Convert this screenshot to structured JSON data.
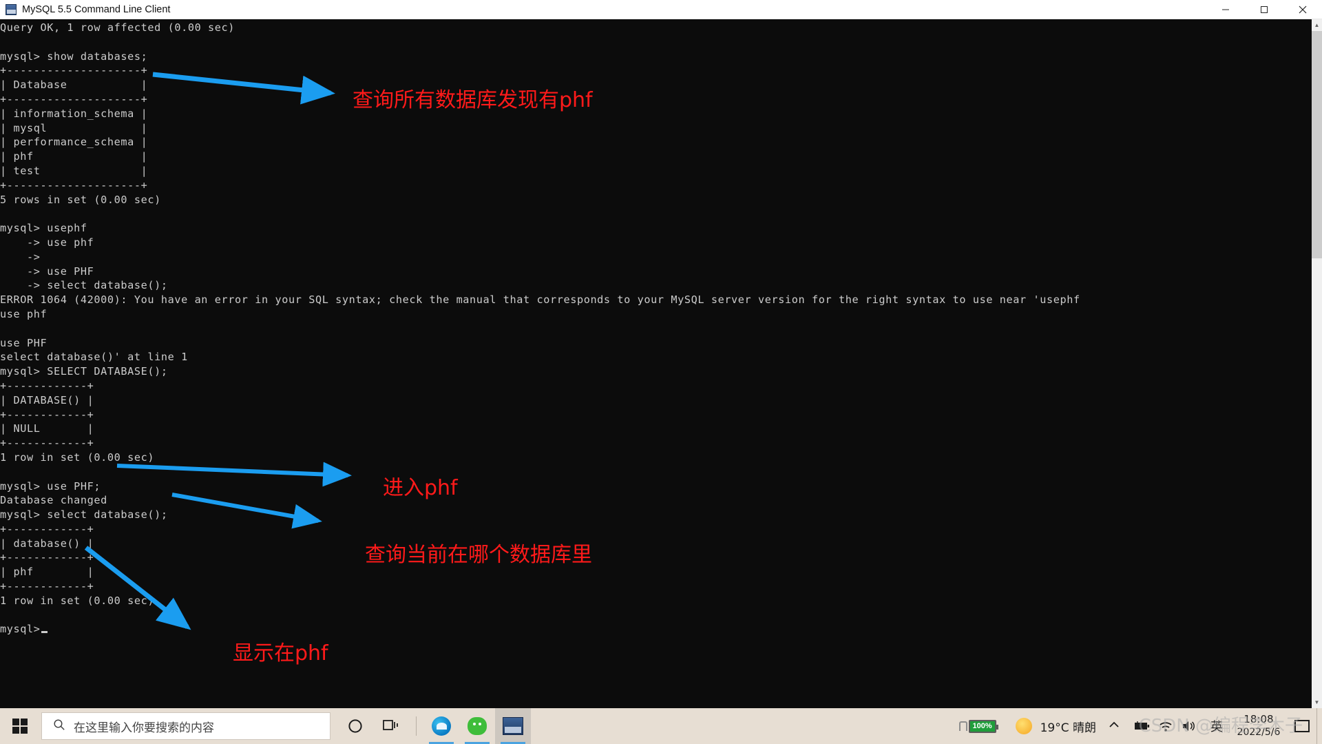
{
  "window": {
    "title": "MySQL 5.5 Command Line Client",
    "app_icon": "mysql-icon",
    "controls": {
      "minimize": "minimize-button",
      "maximize": "maximize-button",
      "close": "close-button"
    }
  },
  "console": {
    "lines": [
      "Query OK, 1 row affected (0.00 sec)",
      "",
      "mysql> show databases;",
      "+--------------------+",
      "| Database           |",
      "+--------------------+",
      "| information_schema |",
      "| mysql              |",
      "| performance_schema |",
      "| phf                |",
      "| test               |",
      "+--------------------+",
      "5 rows in set (0.00 sec)",
      "",
      "mysql> usephf",
      "    -> use phf",
      "    ->",
      "    -> use PHF",
      "    -> select database();",
      "ERROR 1064 (42000): You have an error in your SQL syntax; check the manual that corresponds to your MySQL server version for the right syntax to use near 'usephf",
      "use phf",
      "",
      "use PHF",
      "select database()' at line 1",
      "mysql> SELECT DATABASE();",
      "+------------+",
      "| DATABASE() |",
      "+------------+",
      "| NULL       |",
      "+------------+",
      "1 row in set (0.00 sec)",
      "",
      "mysql> use PHF;",
      "Database changed",
      "mysql> select database();",
      "+------------+",
      "| database() |",
      "+------------+",
      "| phf        |",
      "+------------+",
      "1 row in set (0.00 sec)",
      "",
      "mysql>"
    ],
    "prompt_cursor": "block-cursor"
  },
  "annotations": {
    "color": "#ff1a1a",
    "arrow_color": "#1b9df0",
    "items": [
      {
        "text": "查询所有数据库发现有phf"
      },
      {
        "text": "进入phf"
      },
      {
        "text": "查询当前在哪个数据库里"
      },
      {
        "text": "显示在phf"
      }
    ]
  },
  "taskbar": {
    "start": "start-button",
    "search_placeholder": "在这里输入你要搜索的内容",
    "search_icon": "search-icon",
    "cortana_icon": "cortana-icon",
    "task_view_icon": "task-view-icon",
    "apps": [
      {
        "name": "edge",
        "label": "Microsoft Edge"
      },
      {
        "name": "wechat",
        "label": "WeChat"
      },
      {
        "name": "mysql",
        "label": "MySQL 5.5 Command Line Client"
      }
    ],
    "tray": {
      "battery_percent": "100%",
      "battery_icon": "battery-charging-icon",
      "weather_temp": "19°C  晴朗",
      "weather_icon": "sun-icon",
      "chevron_icon": "chevron-up-icon",
      "battery_tray_icon": "battery-icon",
      "network_icon": "wifi-icon",
      "volume_icon": "speaker-icon",
      "language": "英",
      "time": "18:08",
      "date": "2022/5/6",
      "notification_icon": "notification-center-icon"
    }
  },
  "watermark": {
    "text": "CSDN @编程李木子"
  }
}
